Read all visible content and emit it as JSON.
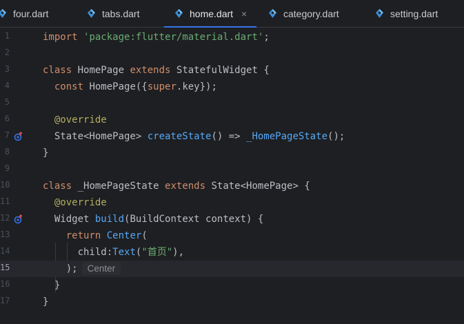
{
  "tabs": [
    {
      "label": "four.dart",
      "icon": "dart-icon",
      "active": false
    },
    {
      "label": "tabs.dart",
      "icon": "dart-icon",
      "active": false
    },
    {
      "label": "home.dart",
      "icon": "dart-icon",
      "active": true,
      "close": "×"
    },
    {
      "label": "category.dart",
      "icon": "dart-icon",
      "active": false
    },
    {
      "label": "setting.dart",
      "icon": "dart-icon",
      "active": false
    }
  ],
  "gutter": {
    "line_numbers": [
      "1",
      "2",
      "3",
      "4",
      "5",
      "6",
      "7",
      "8",
      "9",
      "10",
      "11",
      "12",
      "13",
      "14",
      "15",
      "16",
      "17"
    ],
    "current_line": "15"
  },
  "code": {
    "l1_import": "import",
    "l1_str": "'package:flutter/material.dart'",
    "l1_end": ";",
    "l3_class": "class",
    "l3_name": " HomePage ",
    "l3_extends": "extends",
    "l3_super": " StatefulWidget {",
    "l4_indent": "  ",
    "l4_const": "const",
    "l4_rest1": " HomePage({",
    "l4_super": "super",
    "l4_rest2": ".key});",
    "l6_indent": "  ",
    "l6_ann": "@override",
    "l7_indent": "  ",
    "l7_type": "State<HomePage> ",
    "l7_fn": "createState",
    "l7_mid": "() => ",
    "l7_ctor": "_HomePageState",
    "l7_end": "();",
    "l8": "}",
    "l10_class": "class",
    "l10_name": " _HomePageState ",
    "l10_extends": "extends",
    "l10_rest": " State<HomePage> {",
    "l11_indent": "  ",
    "l11_ann": "@override",
    "l12_indent": "  ",
    "l12_type": "Widget ",
    "l12_fn": "build",
    "l12_rest": "(BuildContext context) {",
    "l13_indent": "    ",
    "l13_return": "return",
    "l13_sp": " ",
    "l13_ctor": "Center",
    "l13_end": "(",
    "l14_indent": "      ",
    "l14_child": "child:",
    "l14_ctor": "Text",
    "l14_open": "(",
    "l14_str": "\"首页\"",
    "l14_end": "),",
    "l15_indent": "    ",
    "l15_code": ");",
    "l15_hint": "Center",
    "l16": "  }",
    "l17": "}"
  },
  "colors": {
    "keyword": "#cf8e6d",
    "string": "#6aab73",
    "function": "#56a8f5",
    "annotation": "#b3ae60",
    "text": "#bcbec4",
    "accent": "#3574f0"
  }
}
